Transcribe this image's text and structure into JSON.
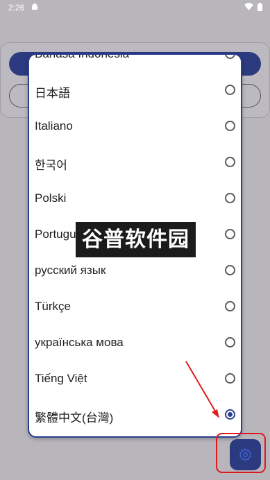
{
  "status_bar": {
    "time": "2:26",
    "notification_icon": "android-robot-icon",
    "wifi_icon": "wifi-icon",
    "battery_icon": "battery-icon"
  },
  "language_dialog": {
    "items": [
      {
        "label": "Bahasa Indonesia",
        "selected": false
      },
      {
        "label": "日本語",
        "selected": false
      },
      {
        "label": "Italiano",
        "selected": false
      },
      {
        "label": "한국어",
        "selected": false
      },
      {
        "label": "Polski",
        "selected": false
      },
      {
        "label": "Português",
        "selected": false
      },
      {
        "label": "русский язык",
        "selected": false
      },
      {
        "label": "Türkçe",
        "selected": false
      },
      {
        "label": "українська мова",
        "selected": false
      },
      {
        "label": "Tiếng Việt",
        "selected": false
      },
      {
        "label": "繁體中文(台灣)",
        "selected": true
      }
    ]
  },
  "watermark": {
    "text": "谷普软件园"
  },
  "fab": {
    "icon": "settings-gear-icon"
  },
  "colors": {
    "accent": "#2c3b80",
    "annotation": "#e0191e",
    "scrim": "#b8b5bb"
  }
}
